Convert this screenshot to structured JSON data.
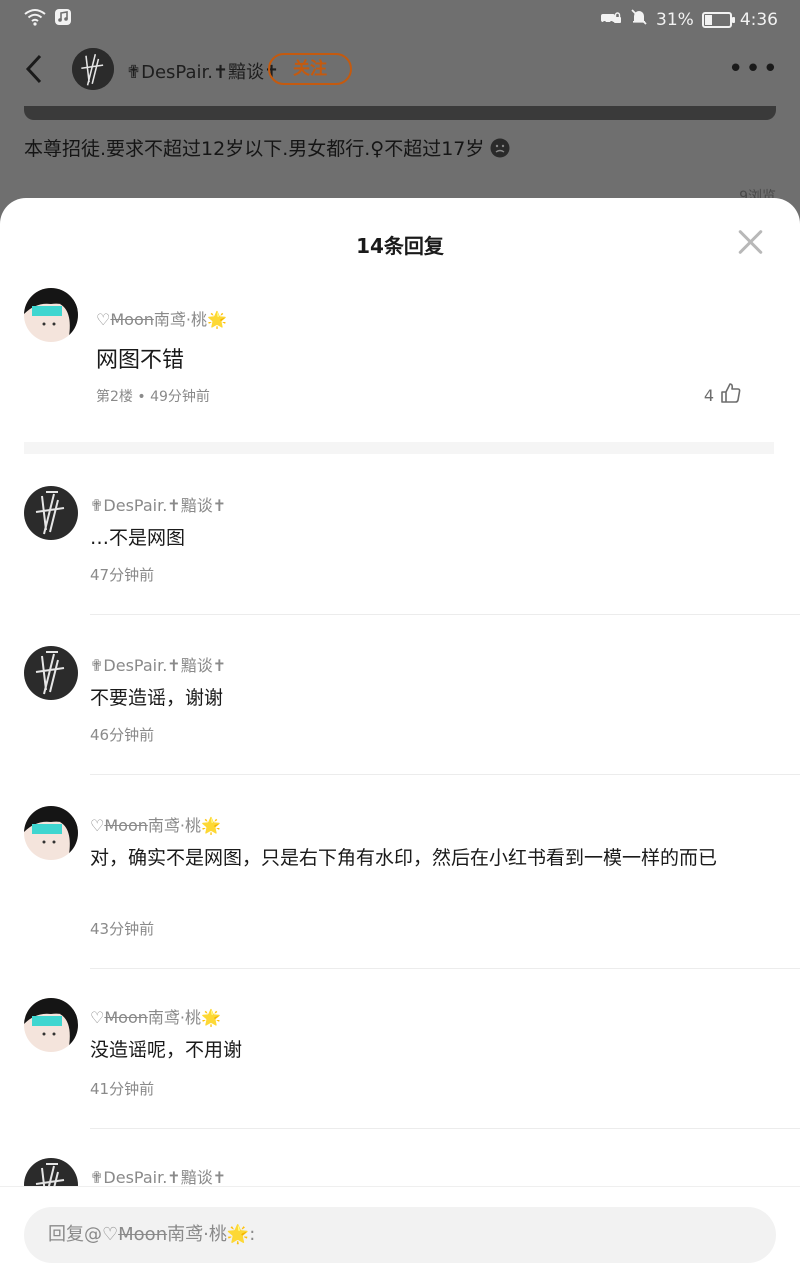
{
  "status_bar": {
    "battery": "31%",
    "battery_level": 0.31,
    "time": "4:36"
  },
  "nav": {
    "author_name": "✟DesPair.✝黯谈✝",
    "follow_label": "关注",
    "more_label": "•••"
  },
  "background_post": {
    "text": "本尊招徒.要求不超过12岁以下.男女都行.♀不超过17岁",
    "views_label": "9浏览"
  },
  "sheet": {
    "title": "14条回复"
  },
  "main_comment": {
    "user_prefix": "♡",
    "user_strike": "Moon",
    "user_suffix": "南鸢·桃🌟",
    "text": "网图不错",
    "meta": "第2楼 • 49分钟前",
    "likes": "4"
  },
  "replies": [
    {
      "user": "✟DesPair.✝黯谈✝",
      "text": "…不是网图",
      "time": "47分钟前",
      "avatar": "despair"
    },
    {
      "user": "✟DesPair.✝黯谈✝",
      "text": "不要造谣，谢谢",
      "time": "46分钟前",
      "avatar": "despair"
    },
    {
      "user_prefix": "♡",
      "user_strike": "Moon",
      "user_suffix": "南鸢·桃🌟",
      "text": "对，确实不是网图，只是右下角有水印，然后在小红书看到一模一样的而已",
      "time": "43分钟前",
      "avatar": "moon"
    },
    {
      "user_prefix": "♡",
      "user_strike": "Moon",
      "user_suffix": "南鸢·桃🌟",
      "text": "没造谣呢，不用谢",
      "time": "41分钟前",
      "avatar": "moon"
    },
    {
      "user": "✟DesPair.✝黯谈✝",
      "avatar": "despair"
    }
  ],
  "input": {
    "prefix": "回复@♡",
    "strike": "Moon",
    "suffix": "南鸢·桃🌟:"
  },
  "colors": {
    "accent": "#c45a0f",
    "overlay": "#6f6f6f"
  }
}
